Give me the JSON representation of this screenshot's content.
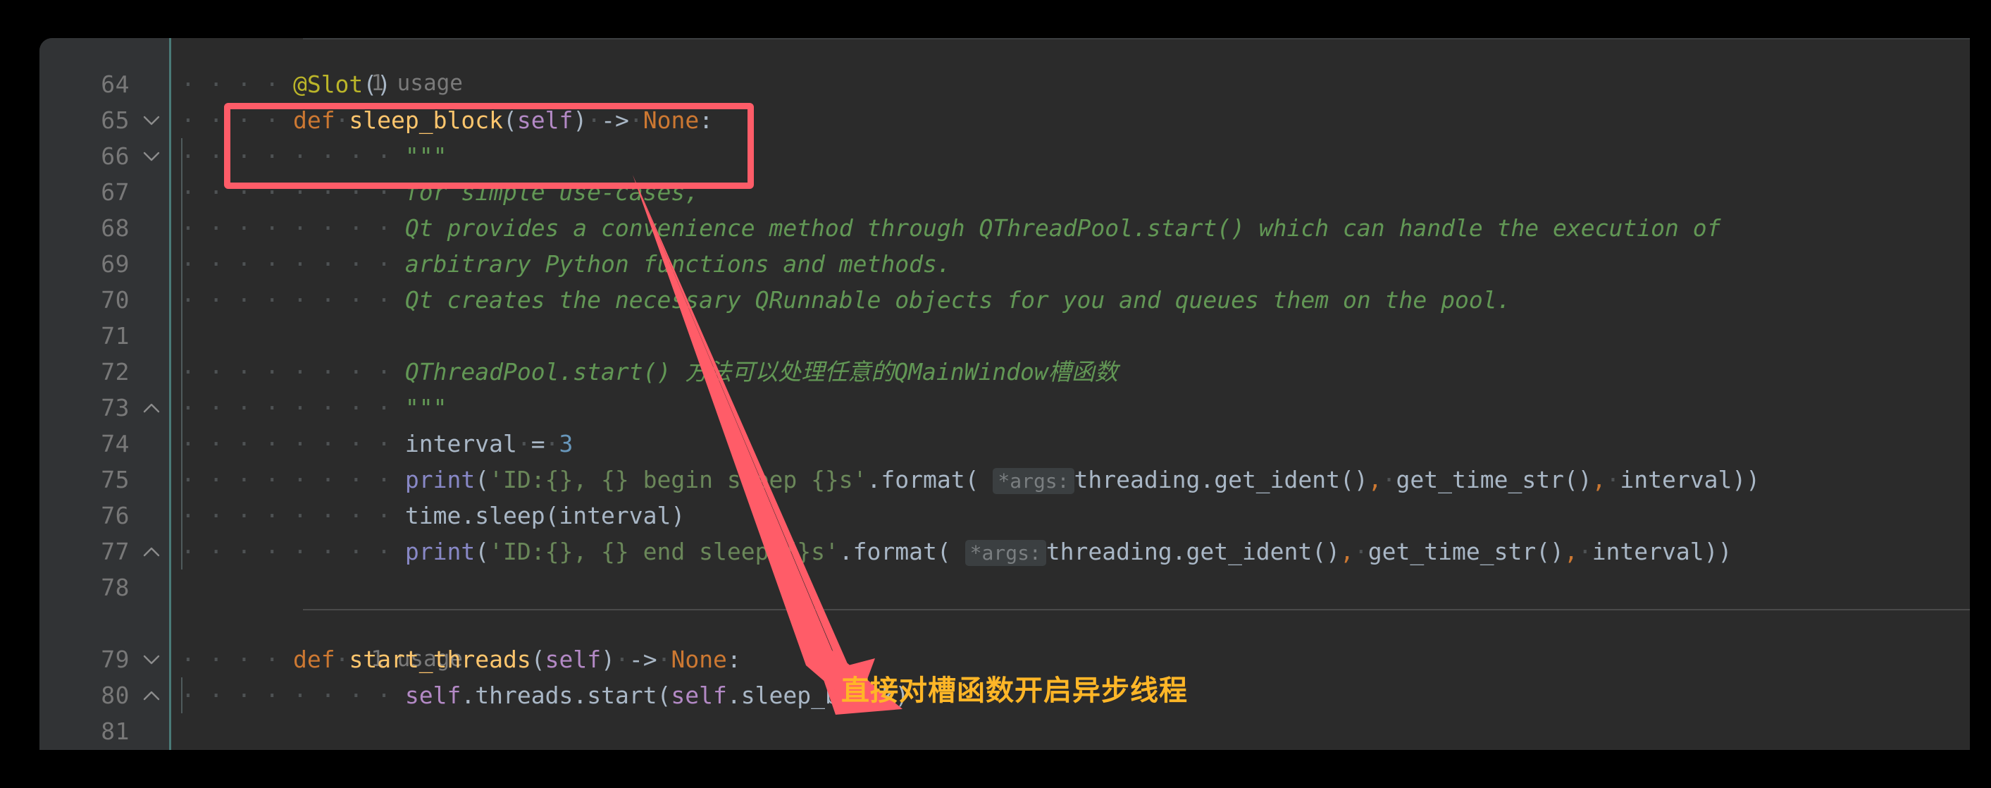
{
  "window": {
    "background_color": "#000000",
    "editor_background": "#2B2B2B",
    "gutter_background": "#313335",
    "gutter_separator_color": "#4A7A78",
    "accent_annotation_color": "#FF5C68",
    "annotation_text_color": "#FFB627"
  },
  "editor": {
    "language": "Python",
    "first_line_number": 64,
    "last_line_number": 81,
    "gutter": [
      {
        "number": "64",
        "fold": "none"
      },
      {
        "number": "65",
        "fold": "down"
      },
      {
        "number": "66",
        "fold": "down"
      },
      {
        "number": "67",
        "fold": "none"
      },
      {
        "number": "68",
        "fold": "none"
      },
      {
        "number": "69",
        "fold": "none"
      },
      {
        "number": "70",
        "fold": "none"
      },
      {
        "number": "71",
        "fold": "none"
      },
      {
        "number": "72",
        "fold": "none"
      },
      {
        "number": "73",
        "fold": "up"
      },
      {
        "number": "74",
        "fold": "none"
      },
      {
        "number": "75",
        "fold": "none"
      },
      {
        "number": "76",
        "fold": "none"
      },
      {
        "number": "77",
        "fold": "up"
      },
      {
        "number": "78",
        "fold": "none"
      },
      {
        "number": "",
        "fold": "none"
      },
      {
        "number": "79",
        "fold": "down"
      },
      {
        "number": "80",
        "fold": "up"
      },
      {
        "number": "81",
        "fold": "none"
      }
    ],
    "usage_hints": [
      {
        "text": "1 usage",
        "row": 0
      },
      {
        "text": "1 usage",
        "row": 15
      }
    ],
    "lines": [
      {
        "n": "64",
        "text": "    @Slot()"
      },
      {
        "n": "65",
        "text": "    def sleep_block(self) -> None:"
      },
      {
        "n": "66",
        "text": "        \"\"\""
      },
      {
        "n": "67",
        "text": "        for simple use-cases,"
      },
      {
        "n": "68",
        "text": "        Qt provides a convenience method through QThreadPool.start() which can handle the execution of"
      },
      {
        "n": "69",
        "text": "        arbitrary Python functions and methods."
      },
      {
        "n": "70",
        "text": "        Qt creates the necessary QRunnable objects for you and queues them on the pool."
      },
      {
        "n": "71",
        "text": ""
      },
      {
        "n": "72",
        "text": "        QThreadPool.start() 方法可以处理任意的QMainWindow槽函数"
      },
      {
        "n": "73",
        "text": "        \"\"\""
      },
      {
        "n": "74",
        "text": "        interval = 3"
      },
      {
        "n": "75",
        "text": "        print('ID:{}, {} begin sleep {}s'.format( *args: threading.get_ident(), get_time_str(), interval))"
      },
      {
        "n": "76",
        "text": "        time.sleep(interval)"
      },
      {
        "n": "77",
        "text": "        print('ID:{}, {} end sleep {}s'.format( *args: threading.get_ident(), get_time_str(), interval))"
      },
      {
        "n": "78",
        "text": ""
      },
      {
        "n": "79",
        "text": "    def start_threads(self) -> None:"
      },
      {
        "n": "80",
        "text": "        self.threads.start(self.sleep_block)"
      },
      {
        "n": "81",
        "text": ""
      }
    ],
    "inlay_hint_label": "*args:"
  },
  "annotation": {
    "highlight_box_target": "@Slot() / def sleep_block(self) -> None:",
    "arrow_label": "arrow-from-slot-decorator-to-start-threads",
    "note_text": "直接对槽函数开启异步线程"
  },
  "tokens": {
    "decorator": "@Slot",
    "def_keyword": "def",
    "fn_sleep_block": "sleep_block",
    "fn_start_threads": "start_threads",
    "self": "self",
    "arrow_op": "->",
    "none_type": "None",
    "interval_name": "interval",
    "interval_value": "3",
    "print_name": "print",
    "str_begin": "'ID:{}, {} begin sleep {}s'",
    "str_end": "'ID:{}, {} end sleep {}s'",
    "format_call": ".format(",
    "threading_get_ident": "threading.get_ident()",
    "get_time_str": "get_time_str()",
    "time_sleep": "time.sleep(interval)",
    "threads_start": "self.threads.start(self.sleep_block)",
    "triple_quote": "\"\"\"",
    "doc_l1": "for simple use-cases,",
    "doc_l2": "Qt provides a convenience method through QThreadPool.start() which can handle the execution of",
    "doc_l3": "arbitrary Python functions and methods.",
    "doc_l4": "Qt creates the necessary QRunnable objects for you and queues them on the pool.",
    "doc_cn": "QThreadPool.start() 方法可以处理任意的QMainWindow槽函数"
  }
}
